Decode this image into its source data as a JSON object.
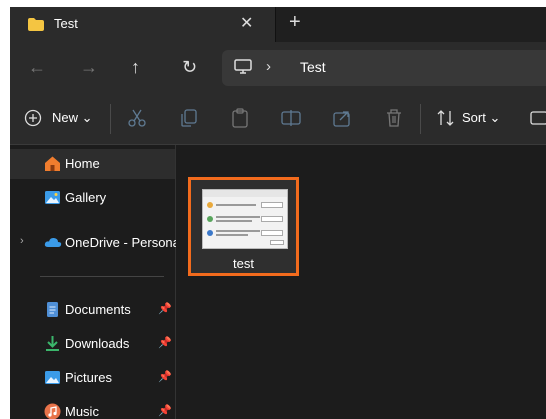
{
  "tab": {
    "title": "Test",
    "close_glyph": "✕",
    "add_glyph": "+"
  },
  "nav": {
    "back_glyph": "←",
    "forward_glyph": "→",
    "up_glyph": "↑",
    "refresh_glyph": "↻"
  },
  "address": {
    "chevron": "›",
    "path": "Test"
  },
  "toolbar": {
    "new_label": "New ⌄",
    "sort_label": "Sort ⌄"
  },
  "sidebar": {
    "items": [
      {
        "label": "Home"
      },
      {
        "label": "Gallery"
      },
      {
        "label": "OneDrive - Persona",
        "expand_glyph": "›"
      },
      {
        "label": "Documents",
        "pin": "📌"
      },
      {
        "label": "Downloads",
        "pin": "📌"
      },
      {
        "label": "Pictures",
        "pin": "📌"
      },
      {
        "label": "Music",
        "pin": "📌"
      }
    ]
  },
  "files": [
    {
      "name": "test"
    }
  ],
  "colors": {
    "selection_border": "#f26b1d",
    "folder": "#f4c542",
    "accent": "#4aa3f0"
  }
}
